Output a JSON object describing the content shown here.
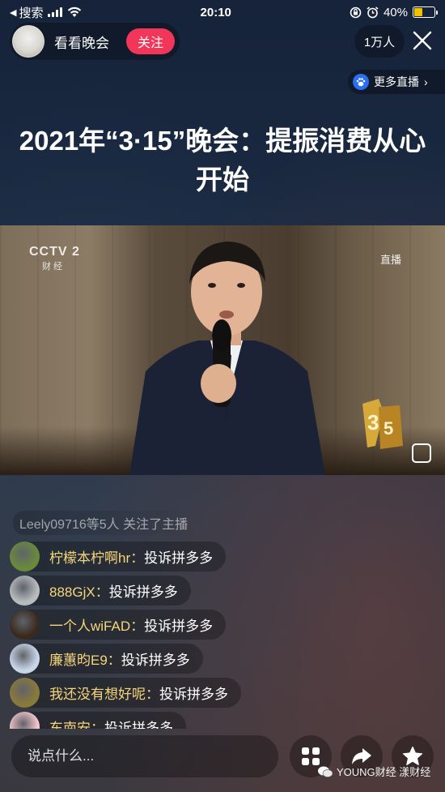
{
  "status_bar": {
    "back_label": "搜索",
    "time": "20:10",
    "battery": "40%",
    "battery_level": 0.4
  },
  "host": {
    "name": "看看晚会",
    "follow_label": "关注"
  },
  "viewers": "1万人",
  "more_live_label": "更多直播",
  "title": "2021年“3·15”晚会：提振消费从心开始",
  "video": {
    "channel_logo": "CCTV 2",
    "channel_sub": "财 经",
    "live_tag": "直播"
  },
  "follow_notice": "Leely09716等5人 关注了主播",
  "chat": [
    {
      "user": "柠檬本柠啊hr：",
      "message": "投诉拼多多",
      "avatar_color": "#6a8a3a"
    },
    {
      "user": "888GjX：",
      "message": "投诉拼多多",
      "avatar_color": "#b9bcbd"
    },
    {
      "user": "一个人wiFAD：",
      "message": "投诉拼多多",
      "avatar_color": "#3a2a1e"
    },
    {
      "user": "廉蕙昀E9：",
      "message": "投诉拼多多",
      "avatar_color": "#c8d6ea"
    },
    {
      "user": "我还没有想好呢：",
      "message": "投诉拼多多",
      "avatar_color": "#8a7a3a"
    },
    {
      "user": "东南安：",
      "message": "投诉拼多多",
      "avatar_color": "#f2c6cc"
    }
  ],
  "input_placeholder": "说点什么...",
  "watermark": "YOUNG财经 漾财经",
  "icons": {
    "back": "triangle-left-icon",
    "wifi": "wifi-icon",
    "lock": "rotation-lock-icon",
    "alarm": "alarm-icon",
    "close": "close-icon",
    "paw": "baidu-paw-icon",
    "expand": "fullscreen-icon",
    "grid": "grid-icon",
    "share": "share-arrow-icon",
    "favorite": "star-icon"
  },
  "colors": {
    "follow_button": "#f2365a",
    "chat_username": "#f5d67a",
    "battery_fill": "#f2c200",
    "more_live_icon": "#2b6ff0"
  }
}
